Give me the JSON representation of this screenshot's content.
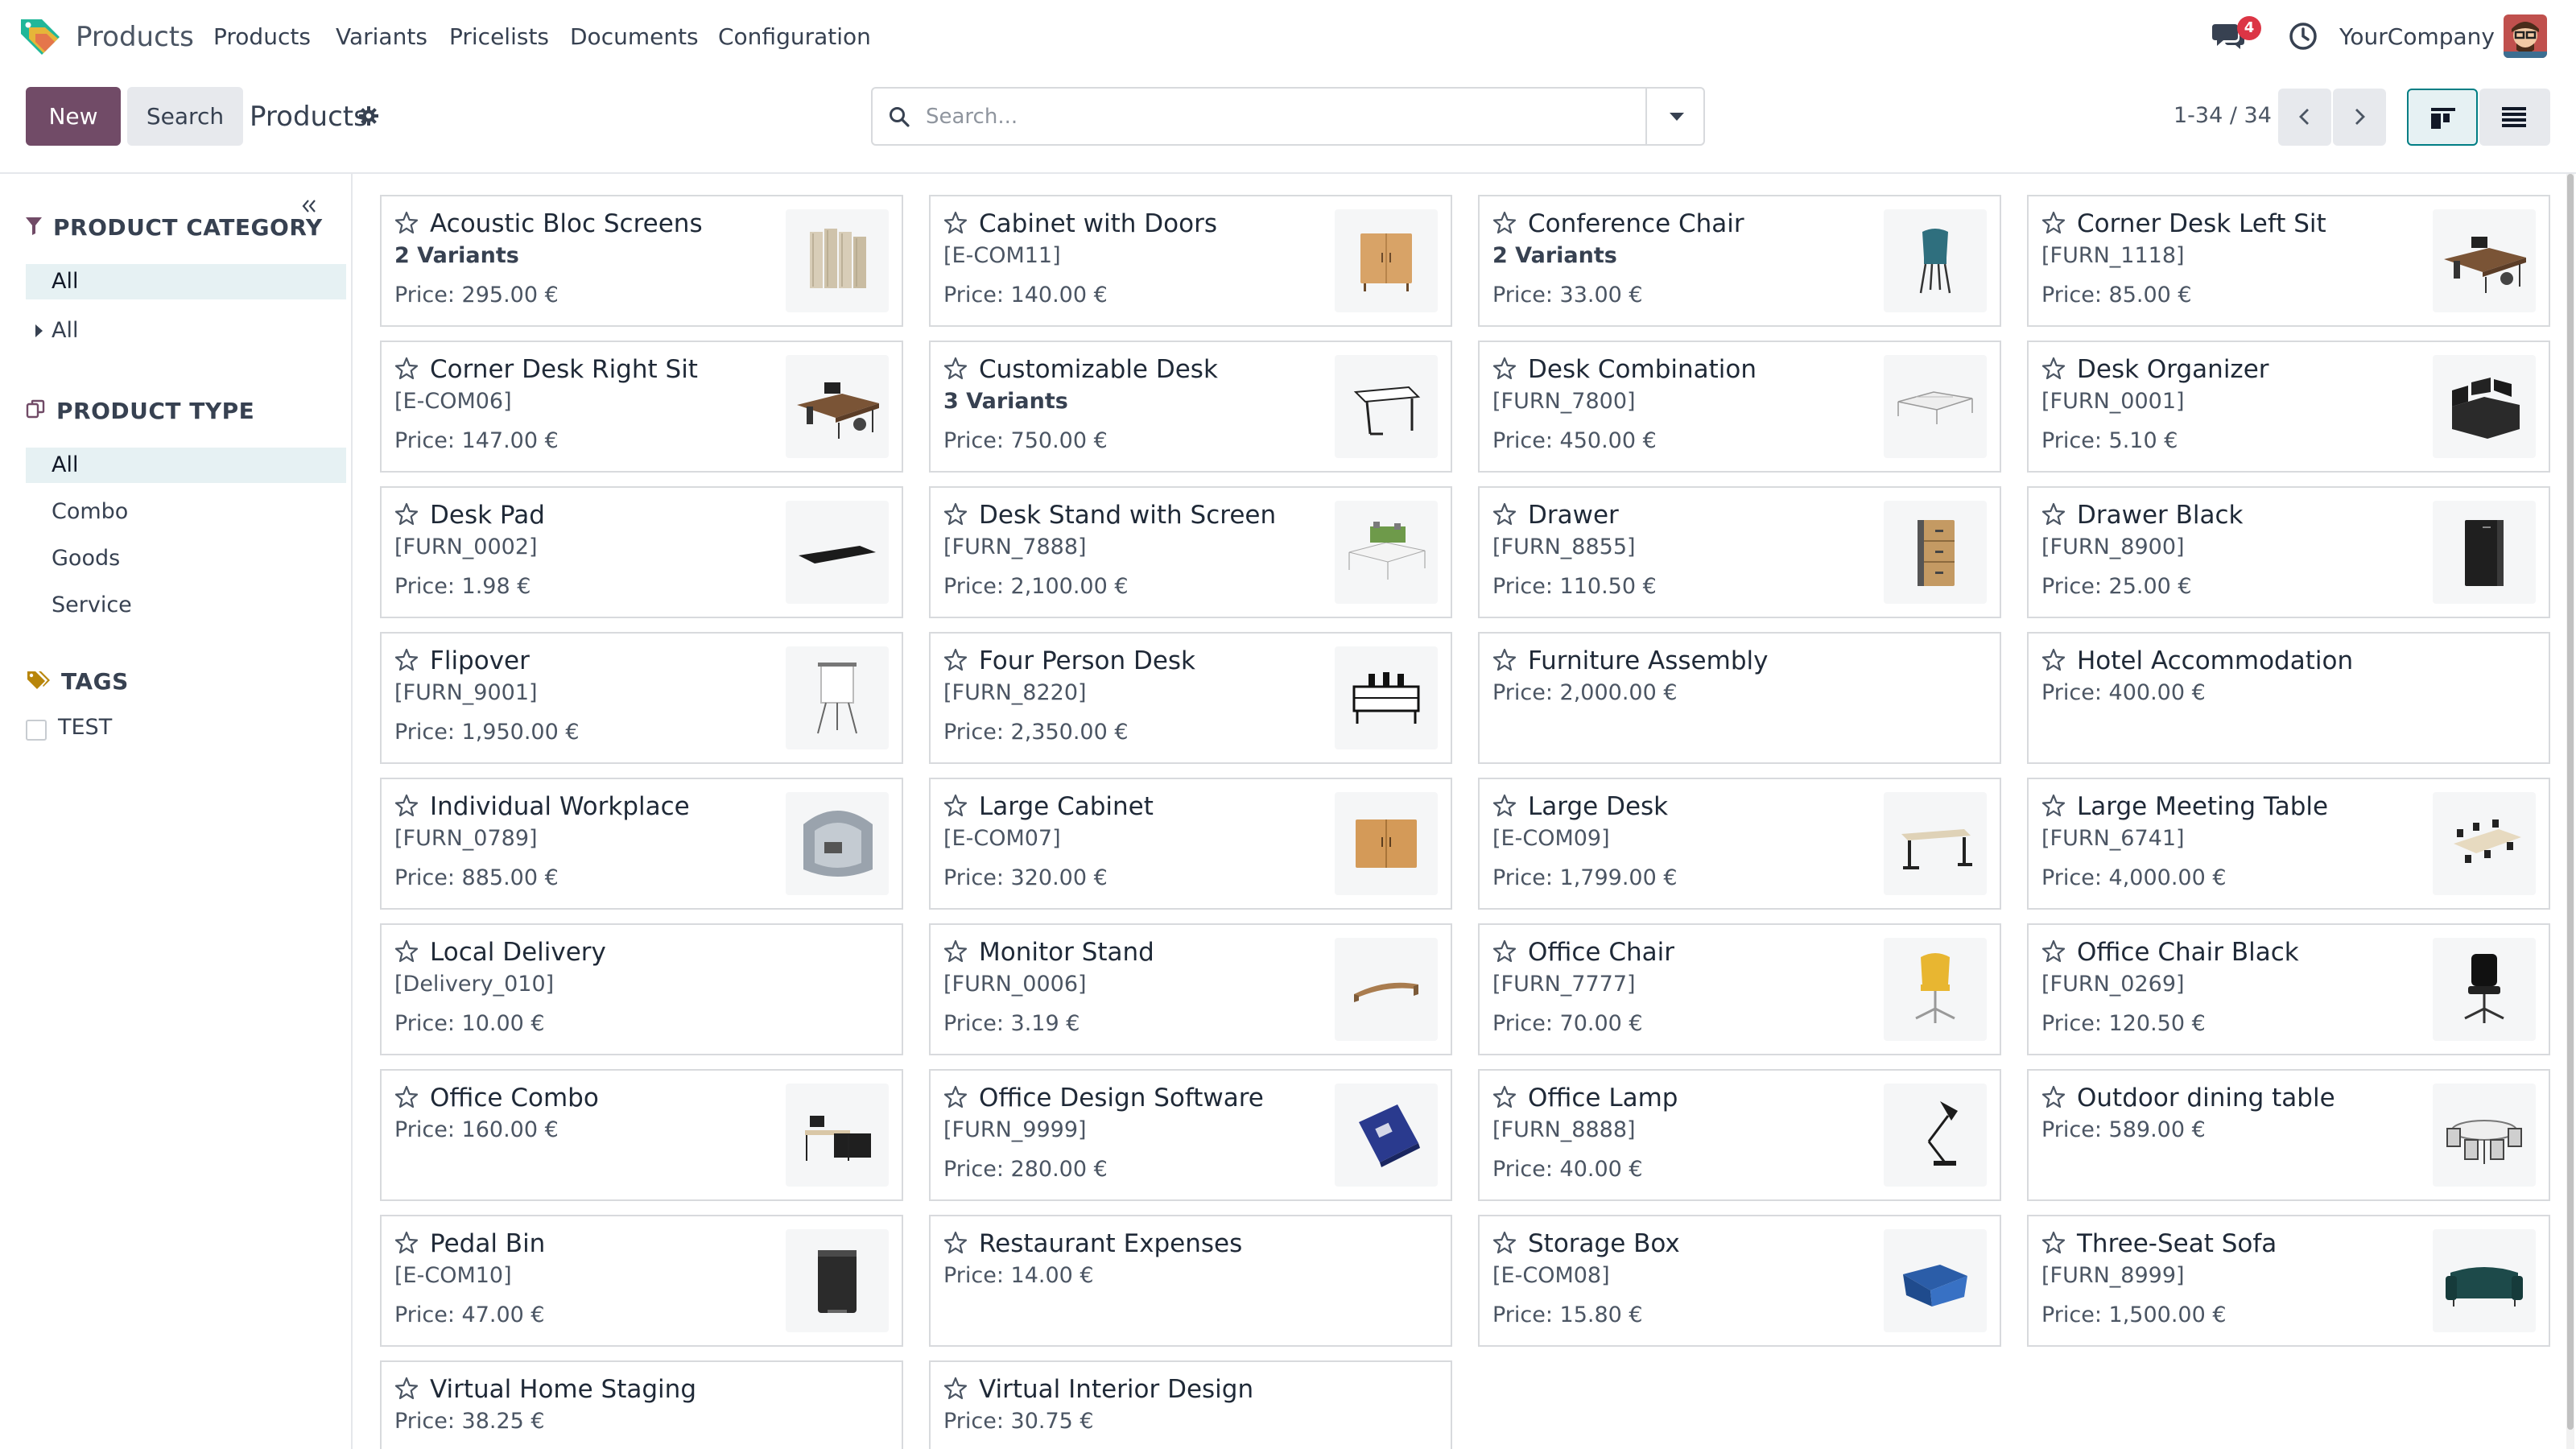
{
  "navbar": {
    "app_name": "Products",
    "menu": [
      "Products",
      "Variants",
      "Pricelists",
      "Documents",
      "Configuration"
    ],
    "chat_badge": "4",
    "company": "YourCompany"
  },
  "control_panel": {
    "new_label": "New",
    "search_label": "Search",
    "title": "Products",
    "search_placeholder": "Search...",
    "pager": "1-34 / 34"
  },
  "sidebar": {
    "category_header": "PRODUCT CATEGORY",
    "category_items": [
      "All",
      "All"
    ],
    "type_header": "PRODUCT TYPE",
    "type_items": [
      "All",
      "Combo",
      "Goods",
      "Service"
    ],
    "tags_header": "TAGS",
    "tags": [
      "TEST"
    ]
  },
  "products": [
    {
      "name": "Acoustic Bloc Screens",
      "sub": "2 Variants",
      "sub_bold": true,
      "price": "Price: 295.00 €",
      "image": "screens"
    },
    {
      "name": "Cabinet with Doors",
      "sub": "[E-COM11]",
      "price": "Price: 140.00 €",
      "image": "cabinet"
    },
    {
      "name": "Conference Chair",
      "sub": "2 Variants",
      "sub_bold": true,
      "price": "Price: 33.00 €",
      "image": "chair"
    },
    {
      "name": "Corner Desk Left Sit",
      "sub": "[FURN_1118]",
      "price": "Price: 85.00 €",
      "image": "cornerdesk"
    },
    {
      "name": "Corner Desk Right Sit",
      "sub": "[E-COM06]",
      "price": "Price: 147.00 €",
      "image": "cornerdesk"
    },
    {
      "name": "Customizable Desk",
      "sub": "3 Variants",
      "sub_bold": true,
      "price": "Price: 750.00 €",
      "image": "desk"
    },
    {
      "name": "Desk Combination",
      "sub": "[FURN_7800]",
      "price": "Price: 450.00 €",
      "image": "deskcombo"
    },
    {
      "name": "Desk Organizer",
      "sub": "[FURN_0001]",
      "price": "Price: 5.10 €",
      "image": "organizer"
    },
    {
      "name": "Desk Pad",
      "sub": "[FURN_0002]",
      "price": "Price: 1.98 €",
      "image": "deskpad"
    },
    {
      "name": "Desk Stand with Screen",
      "sub": "[FURN_7888]",
      "price": "Price: 2,100.00 €",
      "image": "deskscreen"
    },
    {
      "name": "Drawer",
      "sub": "[FURN_8855]",
      "price": "Price: 110.50 €",
      "image": "drawer"
    },
    {
      "name": "Drawer Black",
      "sub": "[FURN_8900]",
      "price": "Price: 25.00 €",
      "image": "drawerblack"
    },
    {
      "name": "Flipover",
      "sub": "[FURN_9001]",
      "price": "Price: 1,950.00 €",
      "image": "flipover"
    },
    {
      "name": "Four Person Desk",
      "sub": "[FURN_8220]",
      "price": "Price: 2,350.00 €",
      "image": "fourdesk"
    },
    {
      "name": "Furniture Assembly",
      "sub": "",
      "price": "Price: 2,000.00 €",
      "image": ""
    },
    {
      "name": "Hotel Accommodation",
      "sub": "",
      "price": "Price: 400.00 €",
      "image": ""
    },
    {
      "name": "Individual Workplace",
      "sub": "[FURN_0789]",
      "price": "Price: 885.00 €",
      "image": "workplace"
    },
    {
      "name": "Large Cabinet",
      "sub": "[E-COM07]",
      "price": "Price: 320.00 €",
      "image": "largecabinet"
    },
    {
      "name": "Large Desk",
      "sub": "[E-COM09]",
      "price": "Price: 1,799.00 €",
      "image": "largedesk"
    },
    {
      "name": "Large Meeting Table",
      "sub": "[FURN_6741]",
      "price": "Price: 4,000.00 €",
      "image": "meeting"
    },
    {
      "name": "Local Delivery",
      "sub": "[Delivery_010]",
      "price": "Price: 10.00 €",
      "image": ""
    },
    {
      "name": "Monitor Stand",
      "sub": "[FURN_0006]",
      "price": "Price: 3.19 €",
      "image": "monitorstand"
    },
    {
      "name": "Office Chair",
      "sub": "[FURN_7777]",
      "price": "Price: 70.00 €",
      "image": "officechair"
    },
    {
      "name": "Office Chair Black",
      "sub": "[FURN_0269]",
      "price": "Price: 120.50 €",
      "image": "chairblack"
    },
    {
      "name": "Office Combo",
      "sub": "",
      "price": "Price: 160.00 €",
      "image": "officecombo"
    },
    {
      "name": "Office Design Software",
      "sub": "[FURN_9999]",
      "price": "Price: 280.00 €",
      "image": "software"
    },
    {
      "name": "Office Lamp",
      "sub": "[FURN_8888]",
      "price": "Price: 40.00 €",
      "image": "lamp"
    },
    {
      "name": "Outdoor dining table",
      "sub": "",
      "price": "Price: 589.00 €",
      "image": "outdoor"
    },
    {
      "name": "Pedal Bin",
      "sub": "[E-COM10]",
      "price": "Price: 47.00 €",
      "image": "bin"
    },
    {
      "name": "Restaurant Expenses",
      "sub": "",
      "price": "Price: 14.00 €",
      "image": ""
    },
    {
      "name": "Storage Box",
      "sub": "[E-COM08]",
      "price": "Price: 15.80 €",
      "image": "storagebox"
    },
    {
      "name": "Three-Seat Sofa",
      "sub": "[FURN_8999]",
      "price": "Price: 1,500.00 €",
      "image": "sofa"
    },
    {
      "name": "Virtual Home Staging",
      "sub": "",
      "price": "Price: 38.25 €",
      "image": ""
    },
    {
      "name": "Virtual Interior Design",
      "sub": "",
      "price": "Price: 30.75 €",
      "image": ""
    }
  ]
}
